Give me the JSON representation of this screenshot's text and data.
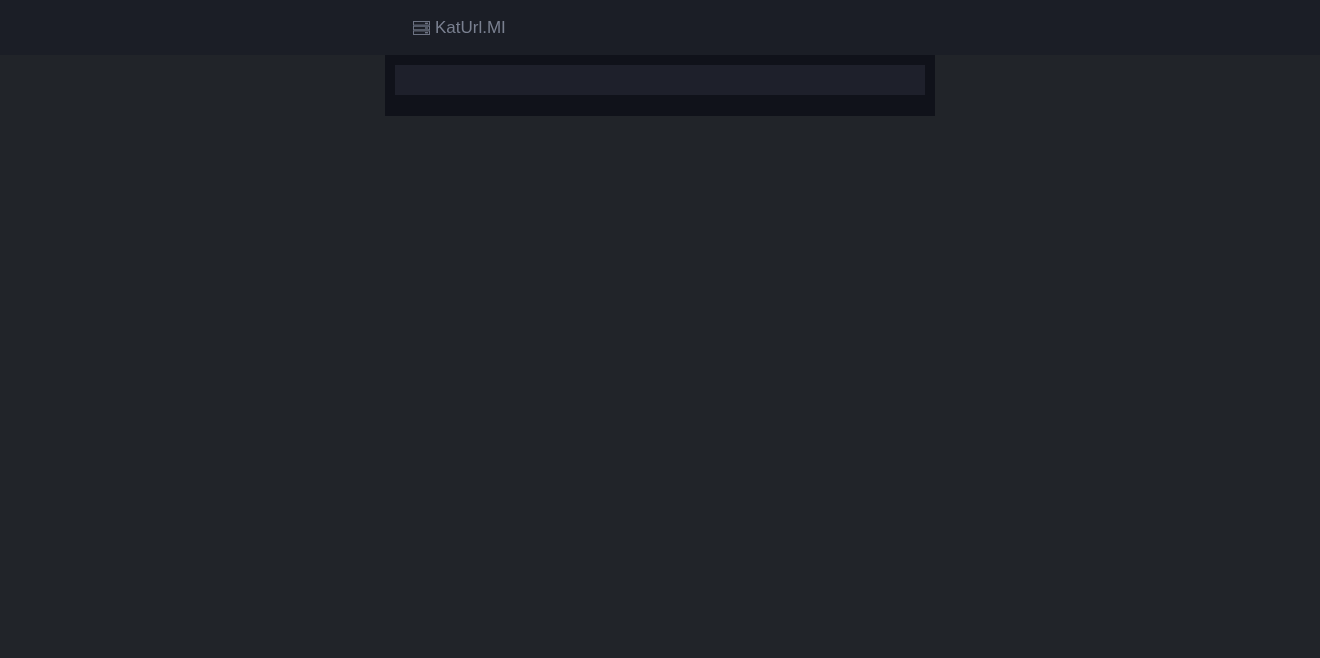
{
  "navbar": {
    "brand": "KatUrl.MI"
  }
}
